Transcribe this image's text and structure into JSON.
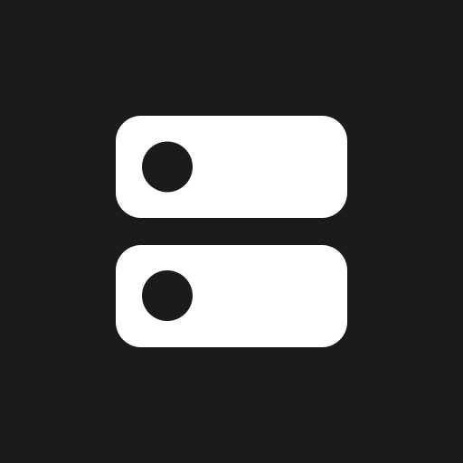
{
  "icon": {
    "name": "server-icon",
    "background_color": "#1b1b1b",
    "foreground_color": "#ffffff",
    "hole_color": "#1b1b1b",
    "units": [
      {
        "name": "server-unit-top"
      },
      {
        "name": "server-unit-bottom"
      }
    ]
  }
}
